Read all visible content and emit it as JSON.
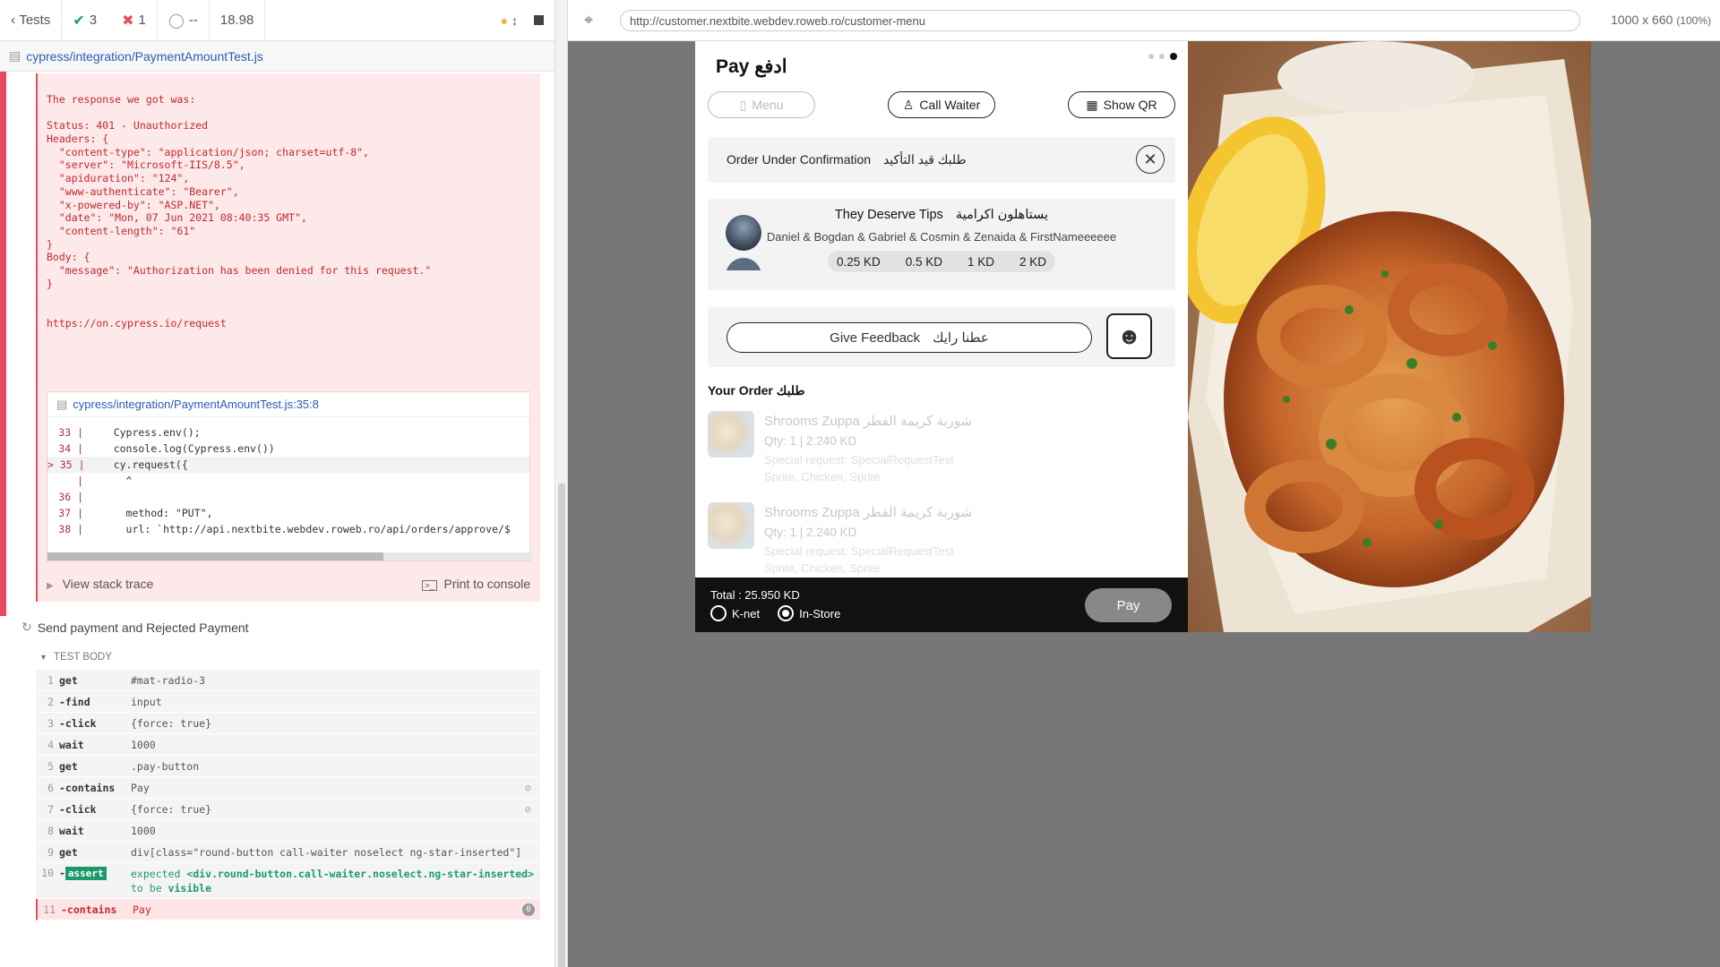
{
  "reporter": {
    "tests_label": "Tests",
    "passed": "3",
    "failed": "1",
    "pending": "--",
    "duration": "18.98",
    "spec_path": "cypress/integration/PaymentAmountTest.js",
    "error_lines": [
      "The response we got was:",
      "",
      "Status: 401 - Unauthorized",
      "Headers: {",
      "  \"content-type\": \"application/json; charset=utf-8\",",
      "  \"server\": \"Microsoft-IIS/8.5\",",
      "  \"apiduration\": \"124\",",
      "  \"www-authenticate\": \"Bearer\",",
      "  \"x-powered-by\": \"ASP.NET\",",
      "  \"date\": \"Mon, 07 Jun 2021 08:40:35 GMT\",",
      "  \"content-length\": \"61\"",
      "}",
      "Body: {",
      "  \"message\": \"Authorization has been denied for this request.\"",
      "}",
      "",
      "",
      "https://on.cypress.io/request"
    ],
    "code_frame": {
      "file": "cypress/integration/PaymentAmountTest.js:35:8",
      "lines": [
        {
          "ln": "33 |",
          "code": "    Cypress.env();"
        },
        {
          "ln": "34 |",
          "code": "    console.log(Cypress.env())"
        },
        {
          "ln": "> 35 |",
          "code": "    cy.request({"
        },
        {
          "ln": "|",
          "code": "      ^"
        },
        {
          "ln": "36 |",
          "code": ""
        },
        {
          "ln": "37 |",
          "code": "      method: \"PUT\","
        },
        {
          "ln": "38 |",
          "code": "      url: `http://api.nextbite.webdev.roweb.ro/api/orders/approve/$"
        }
      ]
    },
    "view_stack": "View stack trace",
    "print_console": "Print to console",
    "test_title": "Send payment and Rejected Payment",
    "test_body": "TEST BODY",
    "commands": [
      {
        "n": "1",
        "name": "get",
        "msg": "#mat-radio-3"
      },
      {
        "n": "2",
        "name": "-find",
        "msg": "input"
      },
      {
        "n": "3",
        "name": "-click",
        "msg": "{force: true}"
      },
      {
        "n": "4",
        "name": "wait",
        "msg": "1000"
      },
      {
        "n": "5",
        "name": "get",
        "msg": ".pay-button"
      },
      {
        "n": "6",
        "name": "-contains",
        "msg": "Pay"
      },
      {
        "n": "7",
        "name": "-click",
        "msg": "{force: true}"
      },
      {
        "n": "8",
        "name": "wait",
        "msg": "1000"
      },
      {
        "n": "9",
        "name": "get",
        "msg": "div[class=\"round-button call-waiter noselect ng-star-inserted\"]"
      },
      {
        "n": "10",
        "name": "assert",
        "msg1": "expected ",
        "msg2": "<div.round-button.call-waiter.noselect.ng-star-inserted>",
        "msg3": "to be ",
        "msg4": "visible"
      },
      {
        "n": "11",
        "name": "-contains",
        "msg": "Pay",
        "badge": "0"
      }
    ]
  },
  "aut": {
    "url": "http://customer.nextbite.webdev.roweb.ro/customer-menu",
    "viewport": "1000 x 660",
    "scale": "(100%)"
  },
  "app": {
    "title": "Pay ادفع",
    "menu_btn": "Menu",
    "call_waiter_btn": "Call Waiter",
    "show_qr_btn": "Show QR",
    "order_status": "Order Under Confirmation",
    "order_status_ar": "طلبك قيد التأكيد",
    "tips_title": "They Deserve Tips",
    "tips_title_ar": "يستاهلون اكرامية",
    "tips_names": "Daniel & Bogdan & Gabriel & Cosmin & Zenaida & FirstNameeeeee",
    "tips": [
      "0.25 KD",
      "0.5 KD",
      "1 KD",
      "2 KD"
    ],
    "feedback": "Give Feedback",
    "feedback_ar": "عطنا رايك",
    "your_order": "Your Order",
    "your_order_ar": "طلبك",
    "items": [
      {
        "name": "Shrooms Zuppa",
        "name_ar": "شوربة كريمة الفطر",
        "qty": "Qty: 1  |  2.240 KD",
        "special": "Special request: SpecialRequestTest",
        "extras": "Sprite, Chicken, Sprite"
      },
      {
        "name": "Shrooms Zuppa",
        "name_ar": "شوربة كريمة الفطر",
        "qty": "Qty: 1  |  2.240 KD",
        "special": "Special request: SpecialRequestTest",
        "extras": "Sprite, Chicken, Sprite"
      }
    ],
    "total": "Total : 25.950 KD",
    "knet": "K-net",
    "instore": "In-Store",
    "pay_btn": "Pay"
  }
}
